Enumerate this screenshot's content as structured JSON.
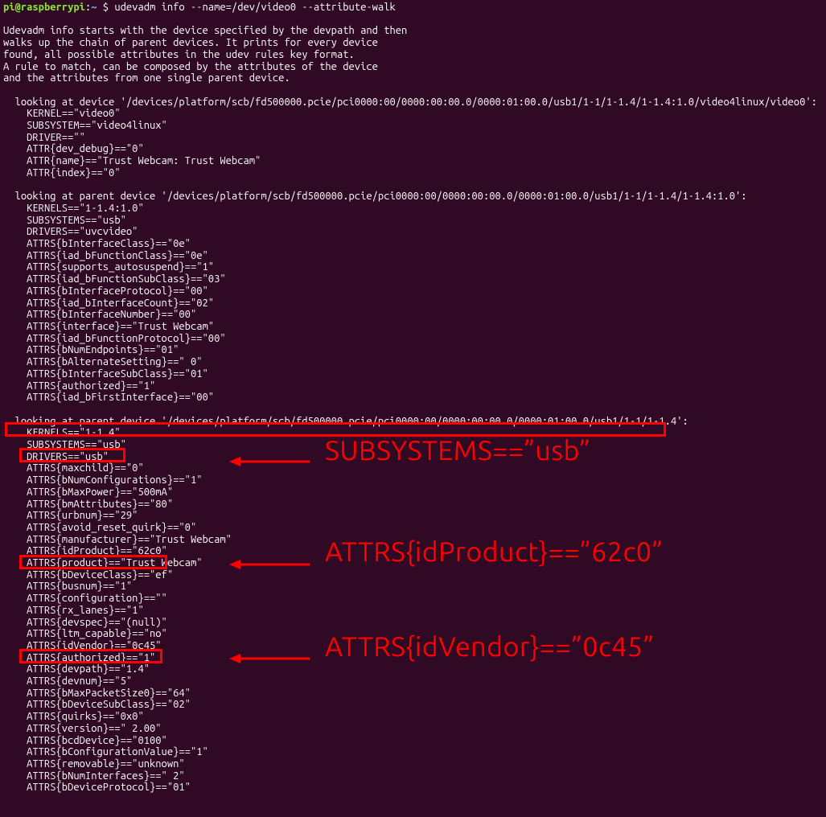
{
  "prompt": {
    "user_host": "pi@raspberrypi",
    "colon": ":",
    "path": "~",
    "dollar": " $ ",
    "command": "udevadm info --name=/dev/video0 --attribute-walk"
  },
  "preamble": [
    "",
    "Udevadm info starts with the device specified by the devpath and then",
    "walks up the chain of parent devices. It prints for every device",
    "found, all possible attributes in the udev rules key format.",
    "A rule to match, can be composed by the attributes of the device",
    "and the attributes from one single parent device.",
    ""
  ],
  "block1": {
    "header": "  looking at device '/devices/platform/scb/fd500000.pcie/pci0000:00/0000:00:00.0/0000:01:00.0/usb1/1-1/1-1.4/1-1.4:1.0/video4linux/video0':",
    "lines": [
      "    KERNEL==\"video0\"",
      "    SUBSYSTEM==\"video4linux\"",
      "    DRIVER==\"\"",
      "    ATTR{dev_debug}==\"0\"",
      "    ATTR{name}==\"Trust Webcam: Trust Webcam\"",
      "    ATTR{index}==\"0\""
    ]
  },
  "block2": {
    "header": "  looking at parent device '/devices/platform/scb/fd500000.pcie/pci0000:00/0000:00:00.0/0000:01:00.0/usb1/1-1/1-1.4/1-1.4:1.0':",
    "lines": [
      "    KERNELS==\"1-1.4:1.0\"",
      "    SUBSYSTEMS==\"usb\"",
      "    DRIVERS==\"uvcvideo\"",
      "    ATTRS{bInterfaceClass}==\"0e\"",
      "    ATTRS{iad_bFunctionClass}==\"0e\"",
      "    ATTRS{supports_autosuspend}==\"1\"",
      "    ATTRS{iad_bFunctionSubClass}==\"03\"",
      "    ATTRS{bInterfaceProtocol}==\"00\"",
      "    ATTRS{iad_bInterfaceCount}==\"02\"",
      "    ATTRS{bInterfaceNumber}==\"00\"",
      "    ATTRS{interface}==\"Trust Webcam\"",
      "    ATTRS{iad_bFunctionProtocol}==\"00\"",
      "    ATTRS{bNumEndpoints}==\"01\"",
      "    ATTRS{bAlternateSetting}==\" 0\"",
      "    ATTRS{bInterfaceSubClass}==\"01\"",
      "    ATTRS{authorized}==\"1\"",
      "    ATTRS{iad_bFirstInterface}==\"00\""
    ]
  },
  "block3": {
    "header": "  looking at parent device '/devices/platform/scb/fd500000.pcie/pci0000:00/0000:00:00.0/0000:01:00.0/usb1/1-1/1-1.4':",
    "lines": [
      "    KERNELS==\"1-1.4\"",
      "    SUBSYSTEMS==\"usb\"",
      "    DRIVERS==\"usb\"",
      "    ATTRS{maxchild}==\"0\"",
      "    ATTRS{bNumConfigurations}==\"1\"",
      "    ATTRS{bMaxPower}==\"500mA\"",
      "    ATTRS{bmAttributes}==\"80\"",
      "    ATTRS{urbnum}==\"29\"",
      "    ATTRS{avoid_reset_quirk}==\"0\"",
      "    ATTRS{manufacturer}==\"Trust Webcam\"",
      "    ATTRS{idProduct}==\"62c0\"",
      "    ATTRS{product}==\"Trust Webcam\"",
      "    ATTRS{bDeviceClass}==\"ef\"",
      "    ATTRS{busnum}==\"1\"",
      "    ATTRS{configuration}==\"\"",
      "    ATTRS{rx_lanes}==\"1\"",
      "    ATTRS{devspec}==\"(null)\"",
      "    ATTRS{ltm_capable}==\"no\"",
      "    ATTRS{idVendor}==\"0c45\"",
      "    ATTRS{authorized}==\"1\"",
      "    ATTRS{devpath}==\"1.4\"",
      "    ATTRS{devnum}==\"5\"",
      "    ATTRS{bMaxPacketSize0}==\"64\"",
      "    ATTRS{bDeviceSubClass}==\"02\"",
      "    ATTRS{quirks}==\"0x0\"",
      "    ATTRS{version}==\" 2.00\"",
      "    ATTRS{bcdDevice}==\"0100\"",
      "    ATTRS{bConfigurationValue}==\"1\"",
      "    ATTRS{removable}==\"unknown\"",
      "    ATTRS{bNumInterfaces}==\" 2\"",
      "    ATTRS{bDeviceProtocol}==\"01\""
    ]
  },
  "annotations": {
    "subsystems": "SUBSYSTEMS==”usb”",
    "idProduct": "ATTRS{idProduct}==”62c0”",
    "idVendor": "ATTRS{idVendor}==”0c45”"
  },
  "colors": {
    "background": "#300a24",
    "text": "#ffffff",
    "prompt_user": "#8ae234",
    "prompt_path": "#729fcf",
    "highlight": "#ff0000"
  }
}
